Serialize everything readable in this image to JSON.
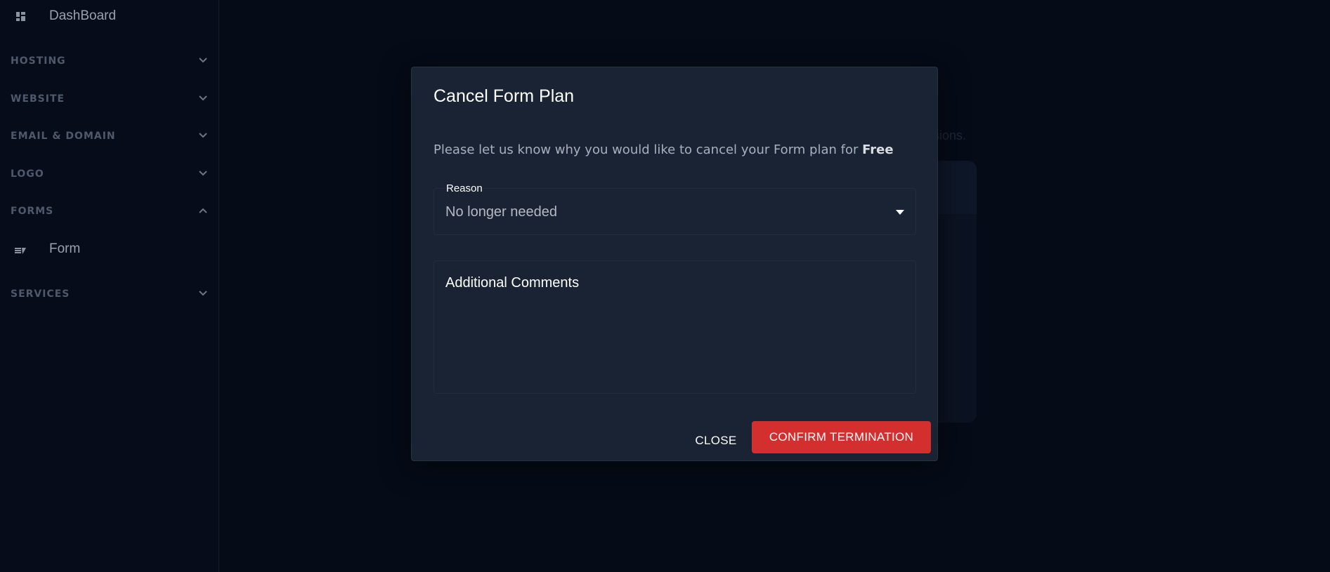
{
  "sidebar": {
    "dashboard_label": "DashBoard",
    "sections": [
      {
        "label": "HOSTING"
      },
      {
        "label": "WEBSITE"
      },
      {
        "label": "EMAIL & DOMAIN"
      },
      {
        "label": "LOGO"
      },
      {
        "label": "FORMS",
        "expanded": true
      },
      {
        "label": "SERVICES"
      }
    ],
    "forms_sub_item": "Form"
  },
  "background": {
    "partial_text": "omissions."
  },
  "modal": {
    "title": "Cancel Form Plan",
    "message": "Please let us know why you would like to cancel your Form plan for ",
    "plan_name": "Free",
    "reason": {
      "label": "Reason",
      "value": "No longer needed"
    },
    "comments": {
      "label": "Additional Comments"
    },
    "close_label": "CLOSE",
    "confirm_label": "CONFIRM TERMINATION"
  },
  "colors": {
    "background": "#050b17",
    "modal": "#1a2333",
    "confirm": "#d32f2f"
  }
}
